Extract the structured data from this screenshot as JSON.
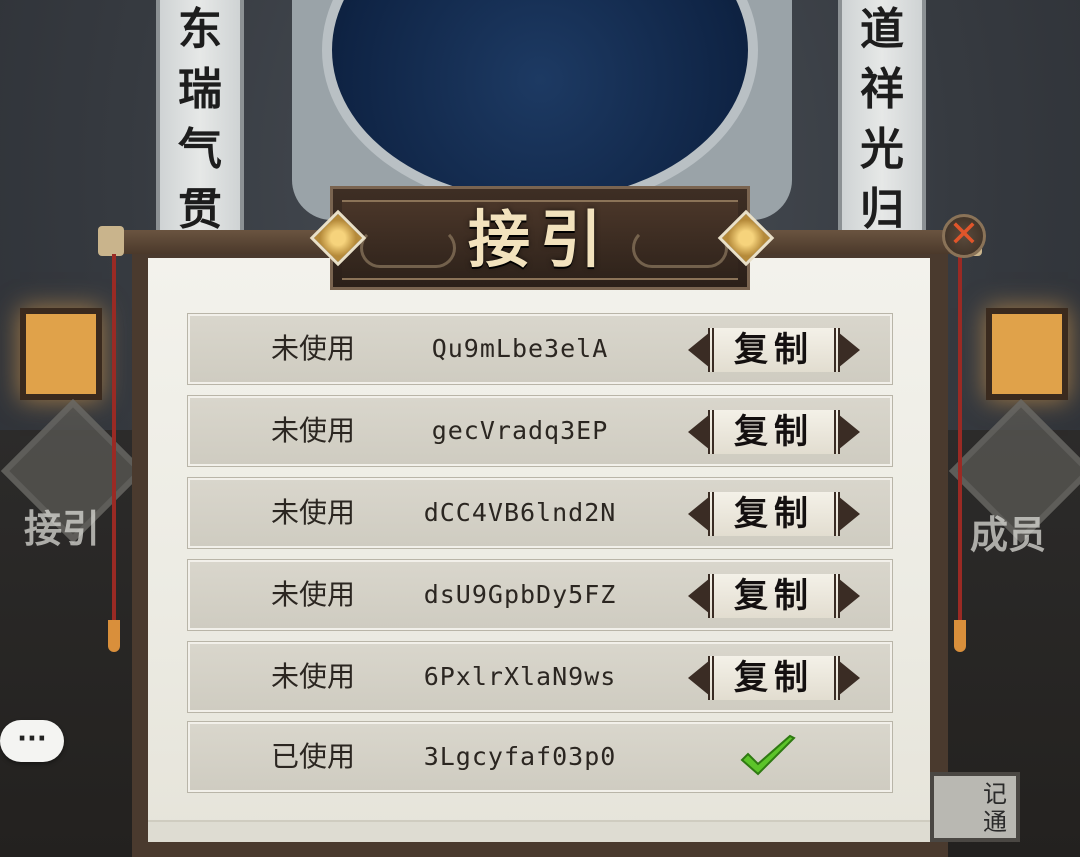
{
  "background": {
    "left_couplet": "东瑞气贯苍",
    "right_couplet": "道祥光归紫",
    "left_side_label": "接引",
    "right_side_label": "成员",
    "corner_button_label": "记通"
  },
  "panel": {
    "title": "接引",
    "close_icon": "✕"
  },
  "codes": [
    {
      "status": "未使用",
      "code": "Qu9mLbe3elA",
      "action": "复制",
      "used": false
    },
    {
      "status": "未使用",
      "code": "gecVradq3EP",
      "action": "复制",
      "used": false
    },
    {
      "status": "未使用",
      "code": "dCC4VB6lnd2N",
      "action": "复制",
      "used": false
    },
    {
      "status": "未使用",
      "code": "dsU9GpbDy5FZ",
      "action": "复制",
      "used": false
    },
    {
      "status": "未使用",
      "code": "6PxlrXlaN9ws",
      "action": "复制",
      "used": false
    },
    {
      "status": "已使用",
      "code": "3Lgcyfaf03p0",
      "action": "",
      "used": true
    }
  ],
  "chat_bubble": "···",
  "colors": {
    "title_text": "#f2e2bd",
    "row_bg": "#d9d6cc",
    "check_green": "#5cc42a",
    "close_red": "#e0552a"
  },
  "icons": [
    "close-icon",
    "checkmark-icon",
    "chat-bubble-icon",
    "diamond-ornament-icon",
    "lantern-icon"
  ]
}
